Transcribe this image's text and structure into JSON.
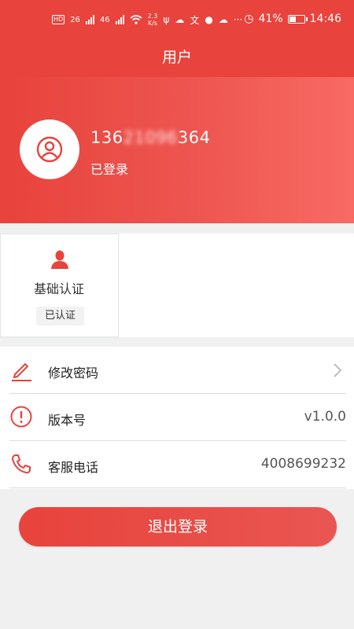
{
  "status_bar": {
    "network_badge": "HD",
    "network_left": "26",
    "network_right": "46",
    "speed_top": "2.3",
    "speed_bottom": "K/s",
    "battery": "41%",
    "time": "14:46"
  },
  "header": {
    "title": "用户"
  },
  "profile": {
    "avatar_icon": "user-circle-icon",
    "phone_visible": "136",
    "phone_masked": "21096",
    "phone_tail": "364",
    "status": "已登录"
  },
  "verification": {
    "icon": "person-icon",
    "label": "基础认证",
    "badge": "已认证"
  },
  "menu": {
    "items": [
      {
        "icon": "edit-pencil-icon",
        "label": "修改密码",
        "value": ""
      },
      {
        "icon": "info-exclamation-icon",
        "label": "版本号",
        "value": "v1.0.0"
      },
      {
        "icon": "phone-icon",
        "label": "客服电话",
        "value": "4008699232"
      }
    ]
  },
  "logout": {
    "label": "退出登录"
  },
  "colors": {
    "brand_red": "#e8433c",
    "gradient_end": "#f86a63"
  }
}
